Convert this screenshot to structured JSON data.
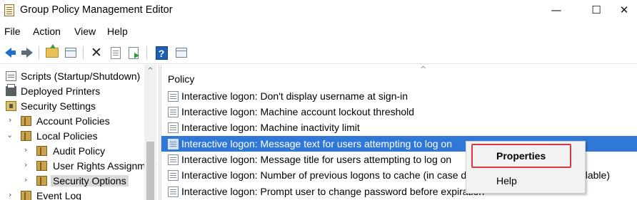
{
  "window": {
    "title": "Group Policy Management Editor",
    "minimize_glyph": "—",
    "maximize_glyph": "☐",
    "close_glyph": "✕"
  },
  "menubar": {
    "items": [
      "File",
      "Action",
      "View",
      "Help"
    ]
  },
  "toolbar": {
    "icons": [
      "back-arrow-icon",
      "forward-arrow-icon",
      "up-folder-icon",
      "show-hide-tree-icon",
      "delete-icon",
      "properties-icon",
      "export-list-icon",
      "help-icon",
      "show-hide-action-pane-icon"
    ],
    "help_glyph": "?"
  },
  "tree": {
    "scroll_up_glyph": "^",
    "items": [
      {
        "label": "Scripts (Startup/Shutdown)",
        "icon": "scroll-icon",
        "expander": ""
      },
      {
        "label": "Deployed Printers",
        "icon": "printer-icon",
        "expander": ""
      },
      {
        "label": "Security Settings",
        "icon": "security-settings-icon",
        "expander": "⌄"
      },
      {
        "label": "Account Policies",
        "icon": "book-icon",
        "expander": "›"
      },
      {
        "label": "Local Policies",
        "icon": "book-icon",
        "expander": "⌄"
      },
      {
        "label": "Audit Policy",
        "icon": "book-icon",
        "expander": "›"
      },
      {
        "label": "User Rights Assignment",
        "icon": "book-icon",
        "expander": "›"
      },
      {
        "label": "Security Options",
        "icon": "book-icon",
        "expander": "›",
        "selected": true
      },
      {
        "label": "Event Log",
        "icon": "book-icon",
        "expander": "›"
      }
    ]
  },
  "policy_list": {
    "column_header": "Policy",
    "sort_glyph": "^",
    "rows": [
      {
        "label": "Interactive logon: Don't display username at sign-in"
      },
      {
        "label": "Interactive logon: Machine account lockout threshold"
      },
      {
        "label": "Interactive logon: Machine inactivity limit"
      },
      {
        "label": "Interactive logon: Message text for users attempting to log on",
        "highlighted": true
      },
      {
        "label": "Interactive logon: Message title for users attempting to log on"
      },
      {
        "label": "Interactive logon: Number of previous logons to cache (in case domain controller is not available)"
      },
      {
        "label": "Interactive logon: Prompt user to change password before expiration"
      }
    ]
  },
  "context_menu": {
    "properties_label": "Properties",
    "help_label": "Help",
    "highlight_color": "#d9383f"
  },
  "colors": {
    "selection_blue": "#2f78d7",
    "tree_selected_gray": "#d9d9d9"
  }
}
